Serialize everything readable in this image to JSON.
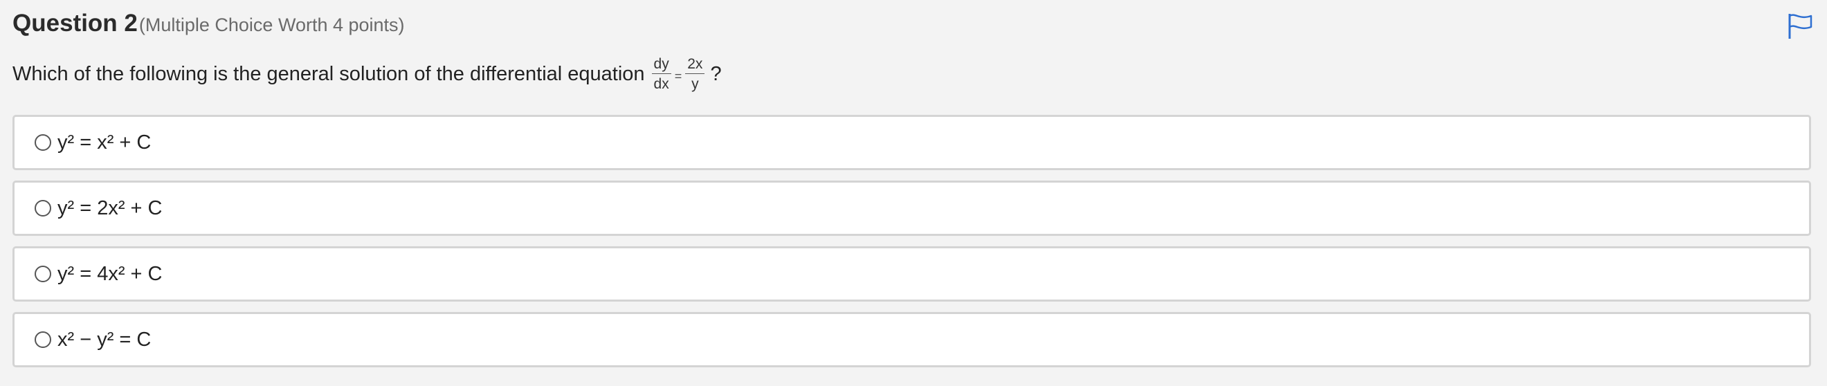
{
  "question": {
    "title": "Question 2",
    "points": "(Multiple Choice Worth 4 points)",
    "prompt_text": "Which of the following is the general solution of the differential equation",
    "equation": {
      "lhs_numerator": "dy",
      "lhs_denominator": "dx",
      "equals": "=",
      "rhs_numerator": "2x",
      "rhs_denominator": "y"
    },
    "prompt_end": "?"
  },
  "options": [
    {
      "label": "y² = x² + C",
      "selected": false
    },
    {
      "label": "y² = 2x² + C",
      "selected": false
    },
    {
      "label": "y² = 4x² + C",
      "selected": false
    },
    {
      "label": "x² − y² = C",
      "selected": false
    }
  ],
  "colors": {
    "flag_icon": "#2e6fd1",
    "background": "#f3f3f3",
    "option_border": "#d4d4d4"
  },
  "icons": {
    "flag": "flag-icon"
  }
}
